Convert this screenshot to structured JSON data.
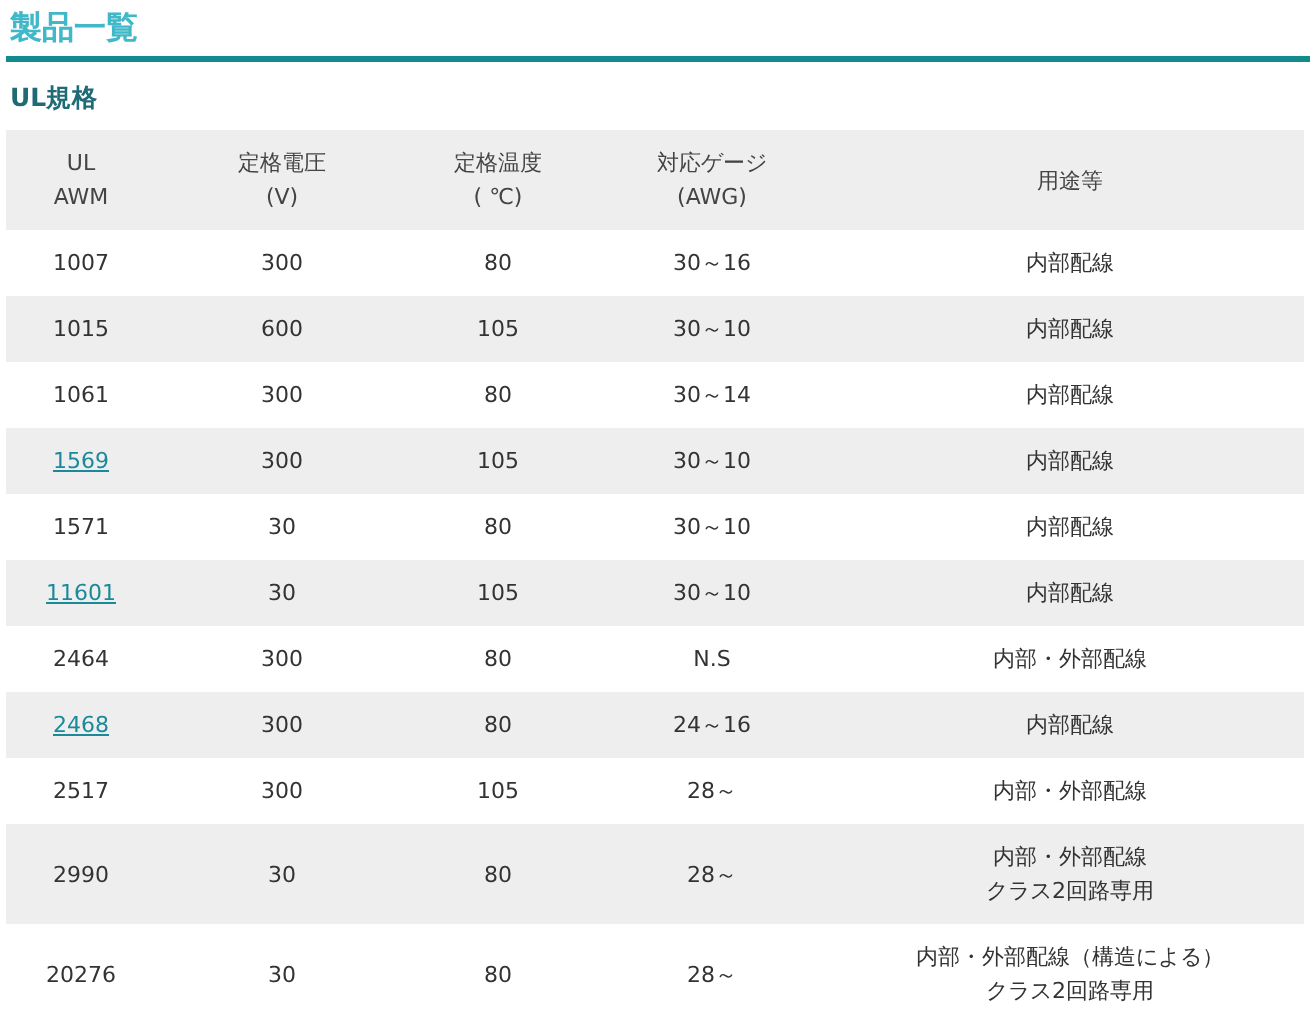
{
  "title": "製品一覧",
  "section": "UL規格",
  "table": {
    "columns": [
      "UL\nAWM",
      "定格電圧\n(V)",
      "定格温度\n( ℃)",
      "対応ゲージ\n(AWG)",
      "用途等"
    ],
    "rows": [
      {
        "awm": "1007",
        "linked": false,
        "voltage": "300",
        "temp": "80",
        "gauge": "30～16",
        "usage": "内部配線"
      },
      {
        "awm": "1015",
        "linked": false,
        "voltage": "600",
        "temp": "105",
        "gauge": "30～10",
        "usage": "内部配線"
      },
      {
        "awm": "1061",
        "linked": false,
        "voltage": "300",
        "temp": "80",
        "gauge": "30～14",
        "usage": "内部配線"
      },
      {
        "awm": "1569",
        "linked": true,
        "voltage": "300",
        "temp": "105",
        "gauge": "30～10",
        "usage": "内部配線"
      },
      {
        "awm": "1571",
        "linked": false,
        "voltage": "30",
        "temp": "80",
        "gauge": "30～10",
        "usage": "内部配線"
      },
      {
        "awm": "11601",
        "linked": true,
        "voltage": "30",
        "temp": "105",
        "gauge": "30～10",
        "usage": "内部配線"
      },
      {
        "awm": "2464",
        "linked": false,
        "voltage": "300",
        "temp": "80",
        "gauge": "N.S",
        "usage": "内部・外部配線"
      },
      {
        "awm": "2468",
        "linked": true,
        "voltage": "300",
        "temp": "80",
        "gauge": "24～16",
        "usage": "内部配線"
      },
      {
        "awm": "2517",
        "linked": false,
        "voltage": "300",
        "temp": "105",
        "gauge": "28～",
        "usage": "内部・外部配線"
      },
      {
        "awm": "2990",
        "linked": false,
        "voltage": "30",
        "temp": "80",
        "gauge": "28～",
        "usage": [
          "内部・外部配線",
          "クラス2回路専用"
        ]
      },
      {
        "awm": "20276",
        "linked": false,
        "voltage": "30",
        "temp": "80",
        "gauge": "28～",
        "usage": [
          "内部・外部配線（構造による）",
          "クラス2回路専用"
        ]
      }
    ]
  }
}
